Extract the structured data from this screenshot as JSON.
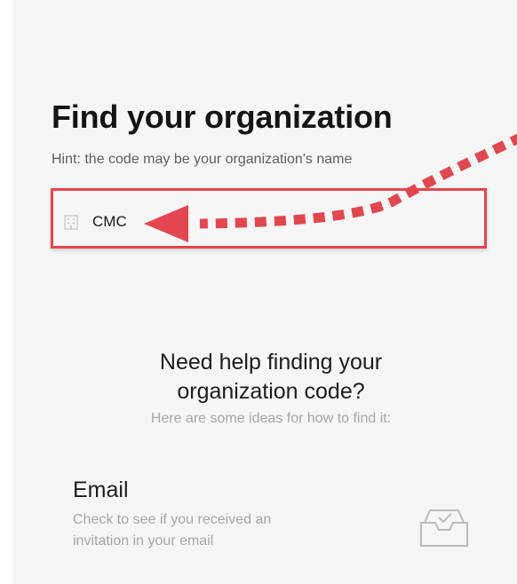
{
  "page": {
    "title": "Find your organization",
    "hint": "Hint: the code may be your organization's name"
  },
  "org_code_field": {
    "value": "CMC",
    "icon": "building-icon"
  },
  "annotation": {
    "color": "#e4464e",
    "box": "highlight-box",
    "arrow": "dotted-arrow"
  },
  "help": {
    "heading_line1": "Need help finding your",
    "heading_line2": "organization code?",
    "subtitle": "Here are some ideas for how to find it:"
  },
  "options": {
    "email": {
      "title": "Email",
      "description_line1": "Check to see if you received an",
      "description_line2": "invitation in your email",
      "icon": "inbox-icon"
    }
  }
}
